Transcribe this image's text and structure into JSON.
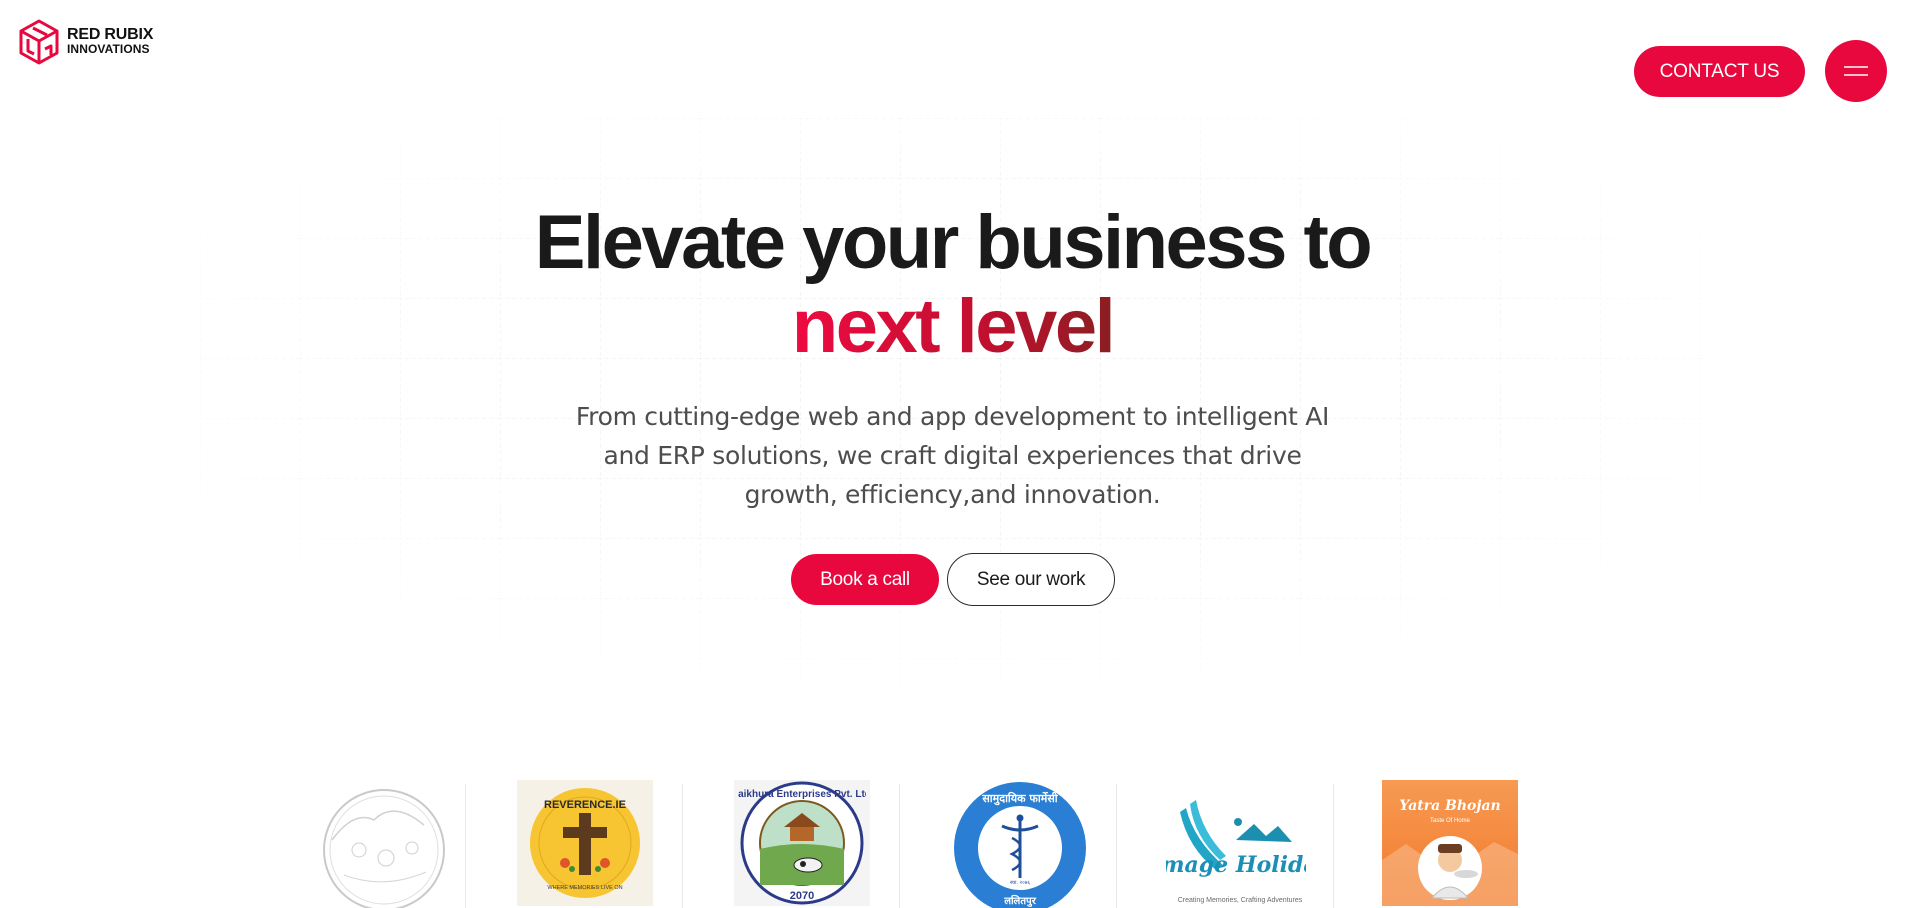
{
  "brand": {
    "line1": "RED RUBIX",
    "line2": "INNOVATIONS",
    "accent_color": "#e8083e"
  },
  "header": {
    "contact_label": "CONTACT US",
    "menu_icon": "hamburger-menu-icon"
  },
  "hero": {
    "title": "Elevate your business to",
    "title_accent": "next level",
    "subtitle_line1": "From cutting-edge web and app development to intelligent AI",
    "subtitle_line2": "and ERP solutions, we craft digital experiences that drive",
    "subtitle_line3": "growth, efficiency,and innovation.",
    "primary_cta": "Book a call",
    "secondary_cta": "See our work"
  },
  "clients": [
    {
      "name": "client-logo-sketch"
    },
    {
      "name": "client-logo-reverence",
      "text_top": "REVERENCE.IE",
      "text_bottom": "WHERE MEMORIES LIVE ON"
    },
    {
      "name": "client-logo-gaikhura",
      "text": "Gaikhura Enterprises Pvt. Ltd.",
      "year": "2070"
    },
    {
      "name": "client-logo-pharmacy",
      "text_top": "सामुदायिक फार्मेसी",
      "text_bottom": "ललितपुर",
      "estd": "स्था. २०७६"
    },
    {
      "name": "client-logo-image-holidays",
      "text": "mage Holidays",
      "tagline": "Creating Memories, Crafting Adventures"
    },
    {
      "name": "client-logo-yatra-bhojan",
      "text": "Yatra Bhojan",
      "tagline": "Taste Of Home"
    }
  ]
}
